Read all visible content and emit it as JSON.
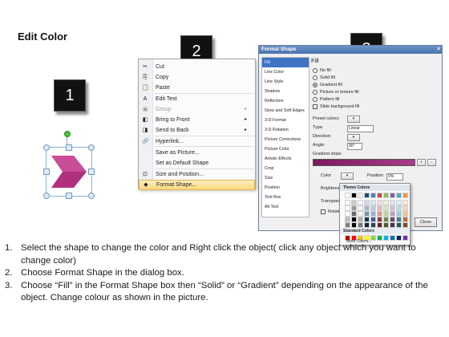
{
  "title": "Edit Color",
  "badges": [
    "1",
    "2",
    "3"
  ],
  "shape": {
    "fill": "#b0307e",
    "highlight": "#d65aa3"
  },
  "context_menu": {
    "items": [
      {
        "label": "Cut",
        "icon": "scissors-icon",
        "glyph": "✂",
        "disabled": false
      },
      {
        "label": "Copy",
        "icon": "copy-icon",
        "glyph": "⎘",
        "disabled": false
      },
      {
        "label": "Paste",
        "icon": "paste-icon",
        "glyph": "📋",
        "disabled": false
      },
      {
        "label": "Edit Text",
        "icon": "edit-text-icon",
        "glyph": "A",
        "disabled": false
      },
      {
        "label": "Group",
        "icon": "group-icon",
        "glyph": "▣",
        "disabled": true,
        "submenu": true
      },
      {
        "label": "Bring to Front",
        "icon": "bring-front-icon",
        "glyph": "◧",
        "disabled": false,
        "submenu": true
      },
      {
        "label": "Send to Back",
        "icon": "send-back-icon",
        "glyph": "◨",
        "disabled": false,
        "submenu": true
      },
      {
        "label": "Hyperlink...",
        "icon": "hyperlink-icon",
        "glyph": "🔗",
        "disabled": false
      },
      {
        "label": "Save as Picture...",
        "icon": "",
        "glyph": "",
        "disabled": false
      },
      {
        "label": "Set as Default Shape",
        "icon": "",
        "glyph": "",
        "disabled": false
      },
      {
        "label": "Size and Position...",
        "icon": "size-position-icon",
        "glyph": "⊡",
        "disabled": false
      },
      {
        "label": "Format Shape...",
        "icon": "format-shape-icon",
        "glyph": "◆",
        "disabled": false,
        "highlighted": true
      }
    ]
  },
  "dialog": {
    "title": "Format Shape",
    "close_glyph": "×",
    "nav": [
      "Fill",
      "Line Color",
      "Line Style",
      "Shadow",
      "Reflection",
      "Glow and Soft Edges",
      "3-D Format",
      "3-D Rotation",
      "Picture Corrections",
      "Picture Color",
      "Artistic Effects",
      "Crop",
      "Size",
      "Position",
      "Text Box",
      "Alt Text"
    ],
    "fill_heading": "Fill",
    "fill_options": [
      "No fill",
      "Solid fill",
      "Gradient fill",
      "Picture or texture fill",
      "Pattern fill",
      "Slide background fill"
    ],
    "selected_option": "Gradient fill",
    "preset_label": "Preset colors:",
    "type_label": "Type:",
    "type_value": "Linear",
    "direction_label": "Direction:",
    "angle_label": "Angle:",
    "angle_value": "90°",
    "gradient_stops_label": "Gradient stops",
    "color_label": "Color",
    "position_label": "Position:",
    "position_value": "0%",
    "brightness_label": "Brightness",
    "transparency_label": "Transparen",
    "rotate_label": "Rotate",
    "close_button": "Close"
  },
  "palette": {
    "theme_label": "Theme Colors",
    "standard_label": "Standard Colors",
    "more_label": "More Colors...",
    "theme_top": [
      "#ffffff",
      "#000000",
      "#eeece1",
      "#1f497d",
      "#4f81bd",
      "#c0504d",
      "#9bbb59",
      "#8064a2",
      "#4bacc6",
      "#f79646"
    ],
    "standard": [
      "#c00000",
      "#ff0000",
      "#ffc000",
      "#ffff00",
      "#92d050",
      "#00b050",
      "#00b0f0",
      "#0070c0",
      "#002060",
      "#7030a0"
    ]
  },
  "steps": [
    {
      "num": "1.",
      "text": "Select the shape to change the color and Right click the object( click any object which you want to change color)"
    },
    {
      "num": "2.",
      "text": "Choose Format Shape in the dialog box."
    },
    {
      "num": "3.",
      "text": "Choose “Fill” in the Format Shape box then “Solid” or “Gradient” depending on the appearance of the object. Change colour as shown in the picture."
    }
  ]
}
